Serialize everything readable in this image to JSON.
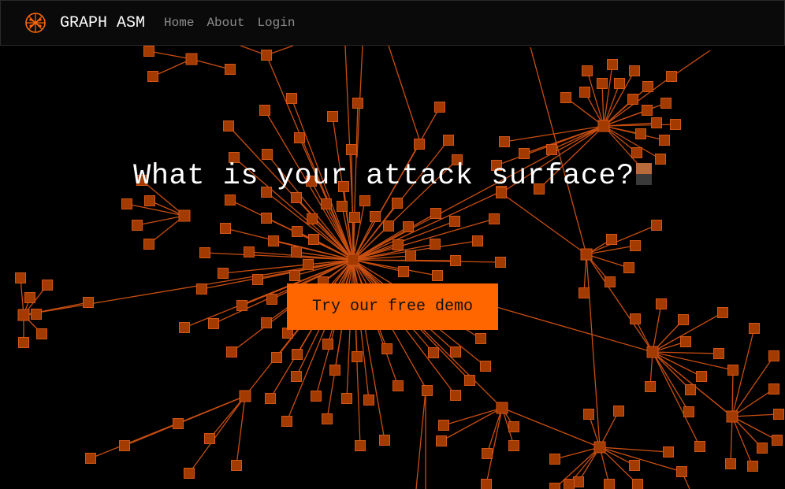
{
  "brand": {
    "name": "GRAPH ASM",
    "logo_icon": "graph-network-icon"
  },
  "nav": {
    "items": [
      {
        "label": "Home"
      },
      {
        "label": "About"
      },
      {
        "label": "Login"
      }
    ]
  },
  "hero": {
    "heading": "What is your attack surface?",
    "cta_label": "Try our free demo"
  },
  "colors": {
    "accent": "#ff6600",
    "node_fill": "#a33a00",
    "node_stroke": "#d2561a",
    "edge": "#c94e10",
    "background": "#000000",
    "navbar_bg": "#0a0a0a",
    "nav_link": "#8d8d8d"
  },
  "background_icon": "network-graph-illustration"
}
